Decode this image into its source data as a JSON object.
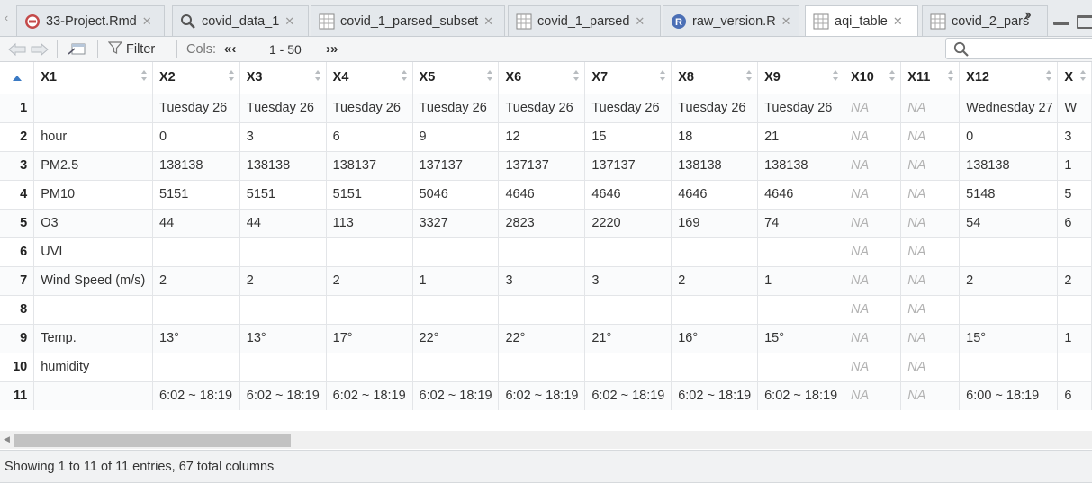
{
  "tabs": [
    {
      "label": "33-Project.Rmd",
      "icon": "rmd-file-icon",
      "active": false
    },
    {
      "label": "covid_data_1",
      "icon": "magnifier-view-icon",
      "active": false
    },
    {
      "label": "covid_1_parsed_subset",
      "icon": "table-grid-icon",
      "active": false
    },
    {
      "label": "covid_1_parsed",
      "icon": "table-grid-icon",
      "active": false
    },
    {
      "label": "raw_version.R",
      "icon": "r-script-icon",
      "active": false
    },
    {
      "label": "aqi_table",
      "icon": "table-grid-icon",
      "active": true
    },
    {
      "label": "covid_2_pars",
      "icon": "table-grid-icon",
      "active": false
    }
  ],
  "toolbar": {
    "filter_label": "Filter",
    "cols_label": "Cols:",
    "cols_range": "1 - 50",
    "prev_cols": "«‹",
    "next_cols": "›»"
  },
  "table": {
    "columns": [
      "X1",
      "X2",
      "X3",
      "X4",
      "X5",
      "X6",
      "X7",
      "X8",
      "X9",
      "X10",
      "X11",
      "X12",
      "X"
    ],
    "rows": [
      {
        "n": "1",
        "cells": [
          "",
          "Tuesday 26",
          "Tuesday 26",
          "Tuesday 26",
          "Tuesday 26",
          "Tuesday 26",
          "Tuesday 26",
          "Tuesday 26",
          "Tuesday 26",
          "NA",
          "NA",
          "Wednesday 27",
          "W"
        ]
      },
      {
        "n": "2",
        "cells": [
          "hour",
          "0",
          "3",
          "6",
          "9",
          "12",
          "15",
          "18",
          "21",
          "NA",
          "NA",
          "0",
          "3"
        ]
      },
      {
        "n": "3",
        "cells": [
          "PM2.5",
          "138138",
          "138138",
          "138137",
          "137137",
          "137137",
          "137137",
          "138138",
          "138138",
          "NA",
          "NA",
          "138138",
          "1"
        ]
      },
      {
        "n": "4",
        "cells": [
          "PM10",
          "5151",
          "5151",
          "5151",
          "5046",
          "4646",
          "4646",
          "4646",
          "4646",
          "NA",
          "NA",
          "5148",
          "5"
        ]
      },
      {
        "n": "5",
        "cells": [
          "O3",
          "44",
          "44",
          "113",
          "3327",
          "2823",
          "2220",
          "169",
          "74",
          "NA",
          "NA",
          "54",
          "6"
        ]
      },
      {
        "n": "6",
        "cells": [
          "UVI",
          "",
          "",
          "",
          "",
          "",
          "",
          "",
          "",
          "NA",
          "NA",
          "",
          ""
        ]
      },
      {
        "n": "7",
        "cells": [
          "Wind Speed (m/s)",
          "2",
          "2",
          "2",
          "1",
          "3",
          "3",
          "2",
          "1",
          "NA",
          "NA",
          "2",
          "2"
        ]
      },
      {
        "n": "8",
        "cells": [
          "",
          "",
          "",
          "",
          "",
          "",
          "",
          "",
          "",
          "NA",
          "NA",
          "",
          ""
        ]
      },
      {
        "n": "9",
        "cells": [
          "Temp.",
          "13°",
          "13°",
          "17°",
          "22°",
          "22°",
          "21°",
          "16°",
          "15°",
          "NA",
          "NA",
          "15°",
          "1"
        ]
      },
      {
        "n": "10",
        "cells": [
          "humidity",
          "",
          "",
          "",
          "",
          "",
          "",
          "",
          "",
          "NA",
          "NA",
          "",
          ""
        ]
      },
      {
        "n": "11",
        "cells": [
          "",
          "6:02 ~ 18:19",
          "6:02 ~ 18:19",
          "6:02 ~ 18:19",
          "6:02 ~ 18:19",
          "6:02 ~ 18:19",
          "6:02 ~ 18:19",
          "6:02 ~ 18:19",
          "6:02 ~ 18:19",
          "NA",
          "NA",
          "6:00 ~ 18:19",
          "6"
        ]
      }
    ]
  },
  "status": {
    "text": "Showing 1 to 11 of 11 entries, 67 total columns"
  },
  "colors": {
    "accent": "#3b7ac4",
    "na_text": "#b2b2b2",
    "tabbar_bg": "#e8ebee"
  }
}
